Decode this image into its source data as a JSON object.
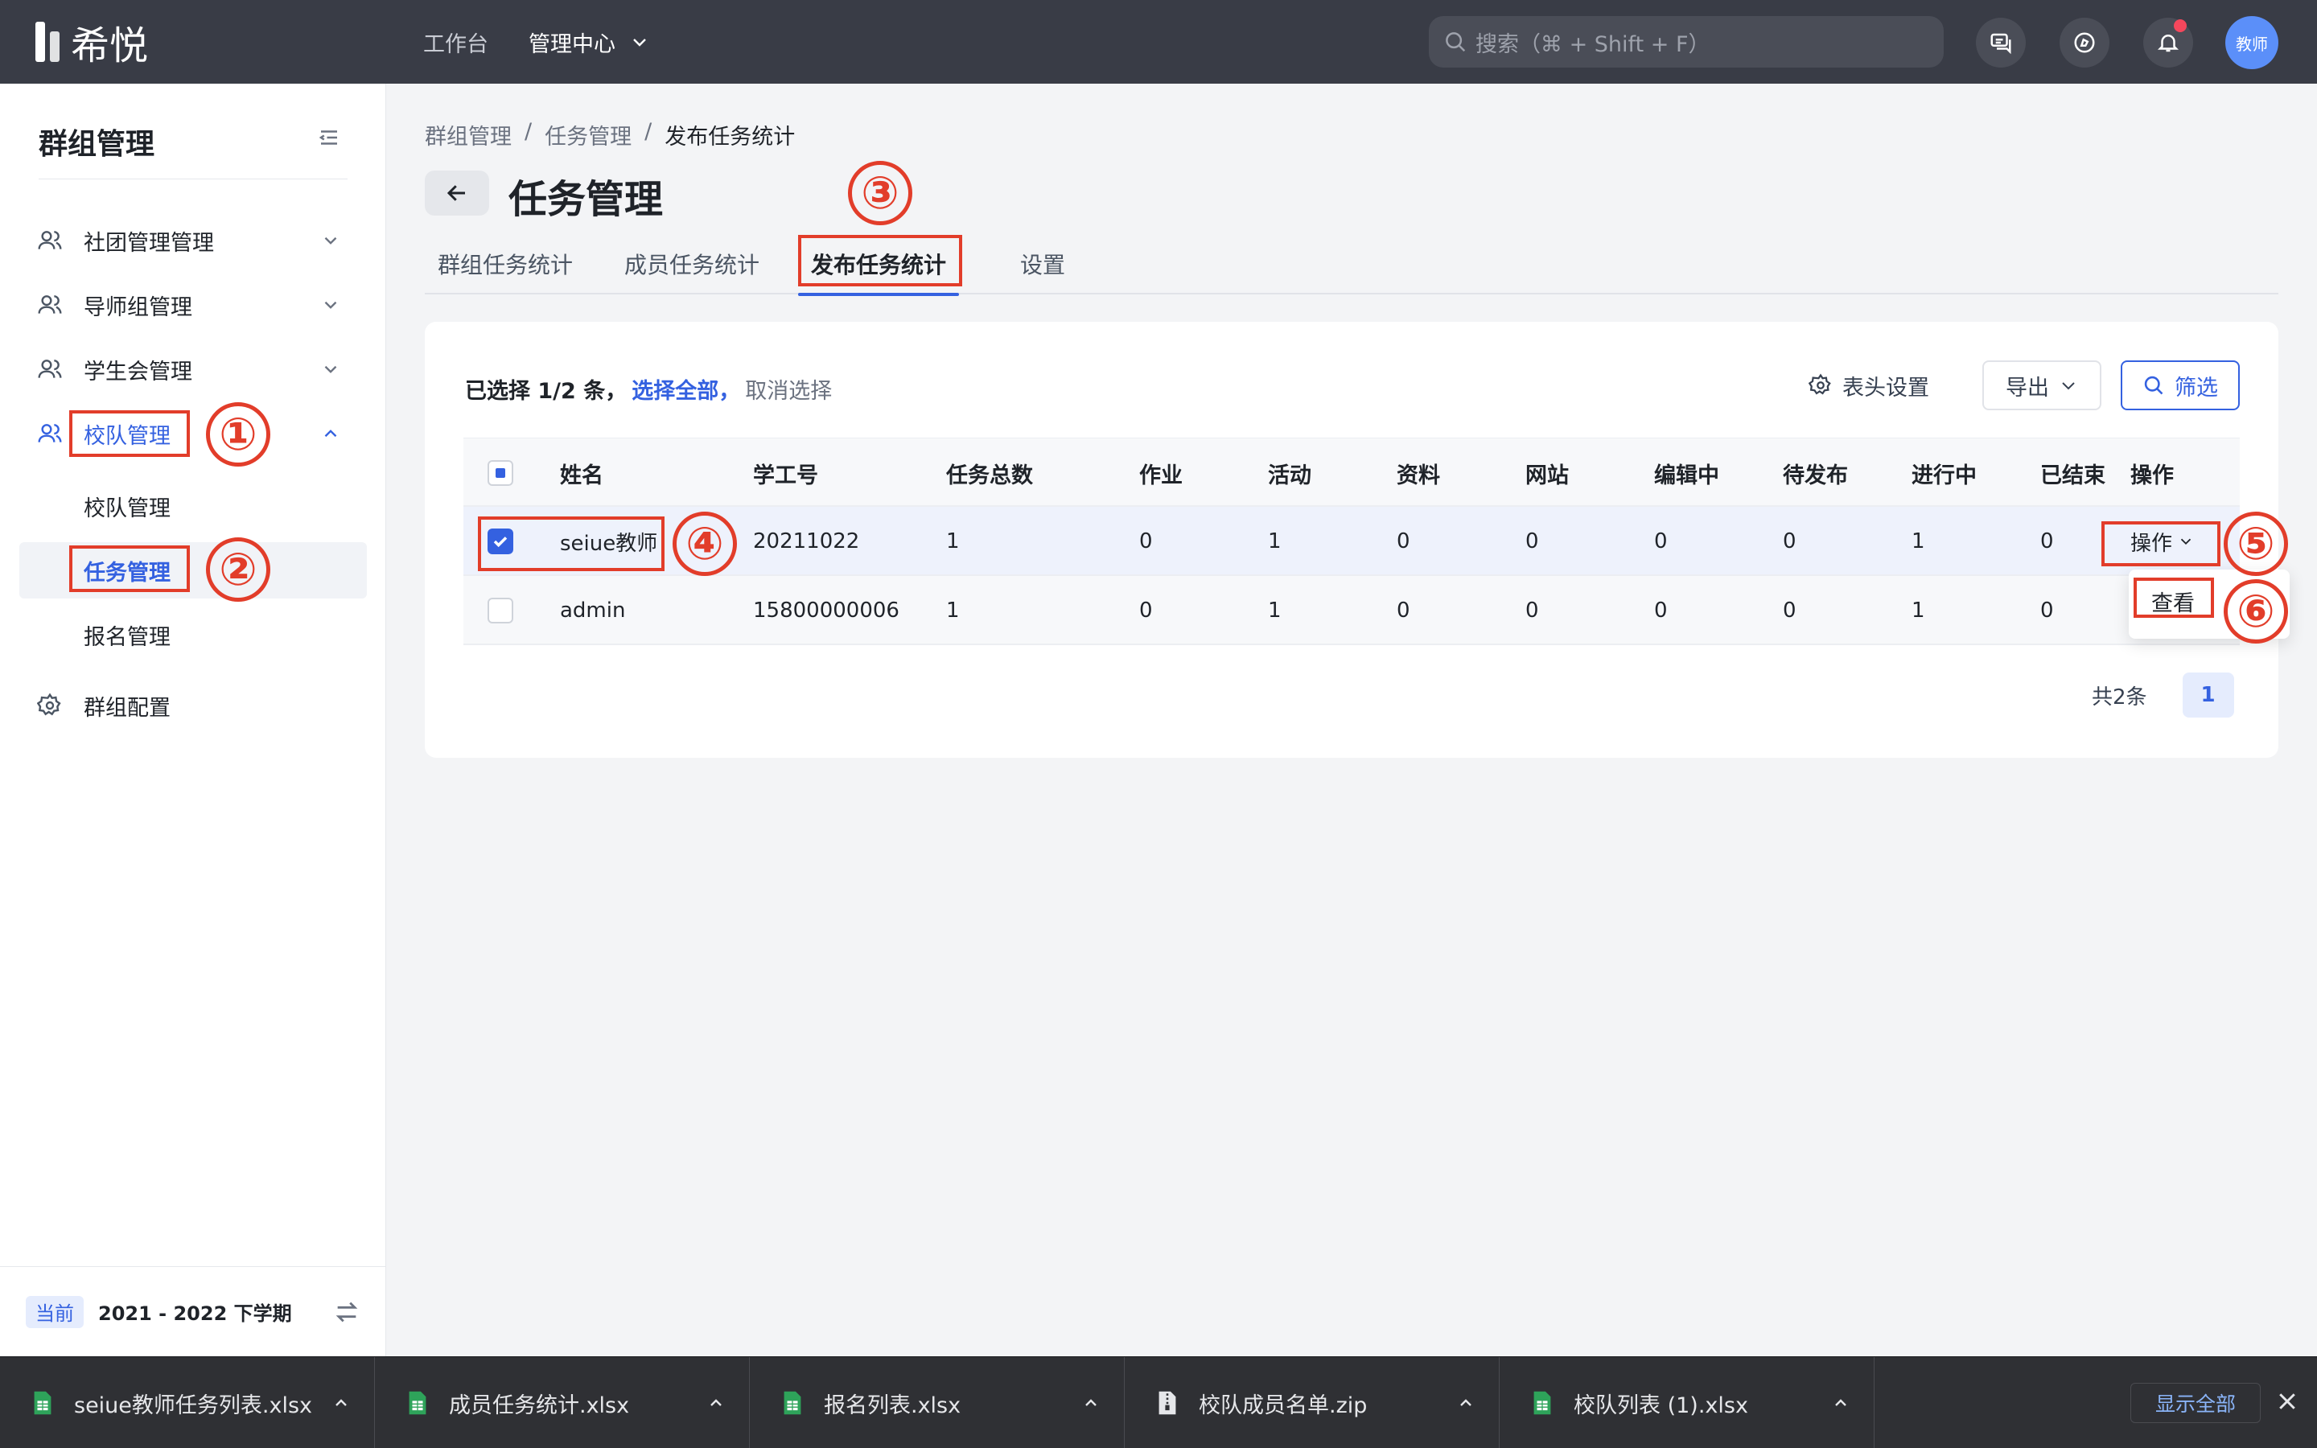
{
  "topbar": {
    "logo_text": "希悦",
    "nav": [
      {
        "label": "工作台"
      },
      {
        "label": "管理中心"
      }
    ],
    "search_placeholder": "搜索（⌘ + Shift + F）",
    "avatar_text": "教师"
  },
  "sidebar": {
    "title": "群组管理",
    "items": [
      {
        "label": "社团管理管理"
      },
      {
        "label": "导师组管理"
      },
      {
        "label": "学生会管理"
      },
      {
        "label": "校队管理"
      }
    ],
    "subitems": [
      {
        "label": "校队管理"
      },
      {
        "label": "任务管理"
      },
      {
        "label": "报名管理"
      }
    ],
    "config_label": "群组配置",
    "term_badge": "当前",
    "term_label": "2021 - 2022 下学期"
  },
  "annotations": [
    "①",
    "②",
    "③",
    "④",
    "⑤",
    "⑥"
  ],
  "main": {
    "breadcrumb": [
      "群组管理",
      "/",
      "任务管理",
      "/",
      "发布任务统计"
    ],
    "title": "任务管理",
    "tabs": [
      {
        "label": "群组任务统计"
      },
      {
        "label": "成员任务统计"
      },
      {
        "label": "发布任务统计",
        "active": true
      },
      {
        "label": "设置"
      }
    ],
    "selection": {
      "selected_text": "已选择 1/2 条，",
      "select_all": "选择全部，",
      "cancel": "取消选择"
    },
    "toolbar": {
      "column_settings": "表头设置",
      "export": "导出",
      "filter": "筛选"
    },
    "table": {
      "headers": [
        "姓名",
        "学工号",
        "任务总数",
        "作业",
        "活动",
        "资料",
        "网站",
        "编辑中",
        "待发布",
        "进行中",
        "已结束",
        "操作"
      ],
      "rows": [
        [
          "seiue教师",
          "20211022",
          "1",
          "0",
          "1",
          "0",
          "0",
          "0",
          "0",
          "1",
          "0",
          "操作"
        ],
        [
          "admin",
          "15800000006",
          "1",
          "0",
          "1",
          "0",
          "0",
          "0",
          "0",
          "1",
          "0",
          ""
        ]
      ]
    },
    "dropdown_item": "查看",
    "pager": {
      "total": "共2条",
      "page": "1"
    }
  },
  "downloads": {
    "files": [
      {
        "name": "seiue教师任务列表.xlsx",
        "kind": "xlsx"
      },
      {
        "name": "成员任务统计.xlsx",
        "kind": "xlsx"
      },
      {
        "name": "报名列表.xlsx",
        "kind": "xlsx"
      },
      {
        "name": "校队成员名单.zip",
        "kind": "zip"
      },
      {
        "name": "校队列表 (1).xlsx",
        "kind": "xlsx"
      }
    ],
    "show_all": "显示全部"
  }
}
